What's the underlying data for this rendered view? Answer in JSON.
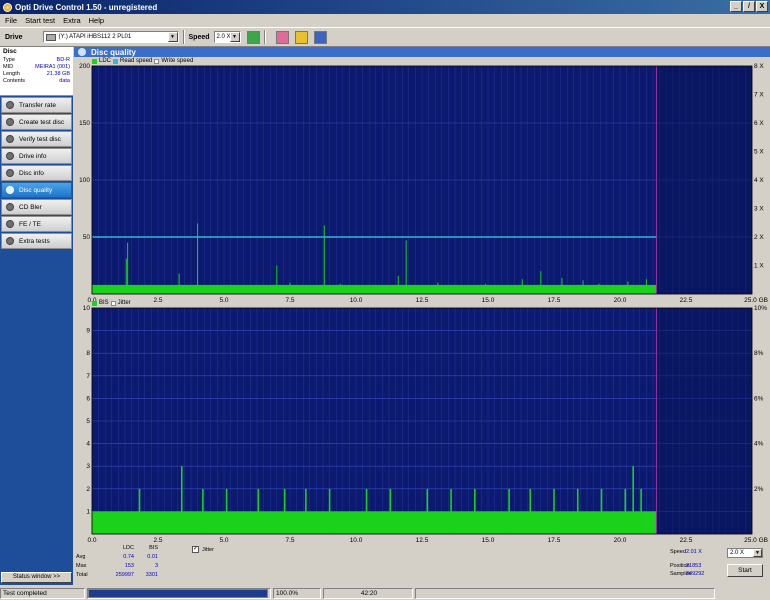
{
  "window": {
    "title": "Opti Drive Control 1.50 - unregistered",
    "btn_min": "_",
    "btn_max": "̸",
    "btn_close": "X"
  },
  "menu": [
    "File",
    "Start test",
    "Extra",
    "Help"
  ],
  "toolbar": {
    "drive_label": "Drive",
    "drive_value": "(Y:)   ATAPI iHBS112  2 PL01",
    "speed_label": "Speed",
    "speed_value": "2.0 X"
  },
  "disc": {
    "header": "Disc",
    "rows": [
      {
        "label": "Type",
        "value": "BD-R"
      },
      {
        "label": "MID",
        "value": "MEIRA1 (001)"
      },
      {
        "label": "Length",
        "value": "21.38 GB"
      },
      {
        "label": "Contents",
        "value": "data"
      }
    ]
  },
  "nav": [
    {
      "label": "Transfer rate",
      "icon": "transfer-icon"
    },
    {
      "label": "Create test disc",
      "icon": "create-disc-icon"
    },
    {
      "label": "Verify test disc",
      "icon": "verify-disc-icon"
    },
    {
      "label": "Drive info",
      "icon": "drive-info-icon"
    },
    {
      "label": "Disc info",
      "icon": "disc-info-icon"
    },
    {
      "label": "Disc quality",
      "icon": "disc-quality-icon",
      "active": true
    },
    {
      "label": "CD Bler",
      "icon": "cd-bler-icon"
    },
    {
      "label": "FE / TE",
      "icon": "fe-te-icon"
    },
    {
      "label": "Extra tests",
      "icon": "extra-tests-icon"
    }
  ],
  "status_window_btn": "Status window >>",
  "panel_title": "Disc quality",
  "legend_top": {
    "ldc": "LDC",
    "read": "Read speed",
    "write": "Write speed"
  },
  "legend_bottom": {
    "bis": "BIS",
    "jitter": "Jitter"
  },
  "colors": {
    "plot_bg": "#0b1a6e",
    "bar": "#19d219",
    "read_line": "#38b4d4",
    "end_line": "#a030a0",
    "grid": "#3a4cc0"
  },
  "chart_data": [
    {
      "type": "bar",
      "series": [
        {
          "name": "LDC"
        },
        {
          "name": "Read speed"
        },
        {
          "name": "Write speed"
        }
      ],
      "x_ticks": [
        "0.0",
        "2.5",
        "5.0",
        "7.5",
        "10.0",
        "12.5",
        "15.0",
        "17.5",
        "20.0",
        "22.5",
        "25.0 GB"
      ],
      "xlim": [
        0,
        25
      ],
      "y_ticks": [
        "200",
        "150",
        "100",
        "50"
      ],
      "ylim": [
        0,
        200
      ],
      "y2_ticks": [
        "8 X",
        "7 X",
        "6 X",
        "5 X",
        "4 X",
        "3 X",
        "2 X",
        "1 X"
      ],
      "disc_end": 21.38,
      "read_speed": 2.0,
      "baseline": 8,
      "spikes": [
        [
          1.3,
          31
        ],
        [
          1.35,
          45
        ],
        [
          3.3,
          18
        ],
        [
          4.0,
          62
        ],
        [
          5.2,
          8
        ],
        [
          7.0,
          25
        ],
        [
          7.5,
          10
        ],
        [
          8.8,
          60
        ],
        [
          9.4,
          9
        ],
        [
          11.6,
          16
        ],
        [
          11.9,
          47
        ],
        [
          13.1,
          10
        ],
        [
          14.9,
          9
        ],
        [
          16.3,
          13
        ],
        [
          17.0,
          20
        ],
        [
          17.8,
          14
        ],
        [
          18.6,
          12
        ],
        [
          19.2,
          9
        ],
        [
          20.3,
          11
        ],
        [
          21.0,
          13
        ]
      ]
    },
    {
      "type": "bar",
      "series": [
        {
          "name": "BIS"
        },
        {
          "name": "Jitter"
        }
      ],
      "x_ticks": [
        "0.0",
        "2.5",
        "5.0",
        "7.5",
        "10.0",
        "12.5",
        "15.0",
        "17.5",
        "20.0",
        "22.5",
        "25.0 GB"
      ],
      "xlim": [
        0,
        25
      ],
      "y_ticks": [
        "10",
        "9",
        "8",
        "7",
        "6",
        "5",
        "4",
        "3",
        "2",
        "1"
      ],
      "ylim": [
        0,
        10
      ],
      "y2_ticks": [
        "10%",
        "8%",
        "6%",
        "4%",
        "2%"
      ],
      "disc_end": 21.38,
      "baseline": 1,
      "spikes": [
        [
          1.8,
          2
        ],
        [
          3.4,
          3
        ],
        [
          4.2,
          2
        ],
        [
          5.1,
          2
        ],
        [
          6.3,
          2
        ],
        [
          7.3,
          2
        ],
        [
          8.1,
          2
        ],
        [
          9.0,
          2
        ],
        [
          10.4,
          2
        ],
        [
          11.3,
          2
        ],
        [
          12.7,
          2
        ],
        [
          13.6,
          2
        ],
        [
          14.5,
          2
        ],
        [
          15.8,
          2
        ],
        [
          16.6,
          2
        ],
        [
          17.5,
          2
        ],
        [
          18.4,
          2
        ],
        [
          19.3,
          2
        ],
        [
          20.2,
          2
        ],
        [
          20.5,
          3
        ],
        [
          20.8,
          2
        ]
      ]
    }
  ],
  "stats": {
    "hdr_ldc": "LDC",
    "hdr_bis": "BIS",
    "avg_label": "Avg",
    "max_label": "Max",
    "total_label": "Total",
    "avg_ldc": "0.74",
    "avg_bis": "0.01",
    "max_ldc": "153",
    "max_bis": "3",
    "total_ldc": "259997",
    "total_bis": "3301",
    "jitter_label": "Jitter",
    "jitter_check": "✓",
    "speed_label": "Speed",
    "speed_value": "2.01 X",
    "speed_select": "2.0 X",
    "position_label": "Position",
    "position_value": "21853",
    "samples_label": "Samples",
    "samples_value": "349292",
    "start_btn": "Start"
  },
  "statusbar": {
    "text": "Test completed",
    "progress": "100.0%",
    "time": "42:20",
    "progress_value": 100
  }
}
